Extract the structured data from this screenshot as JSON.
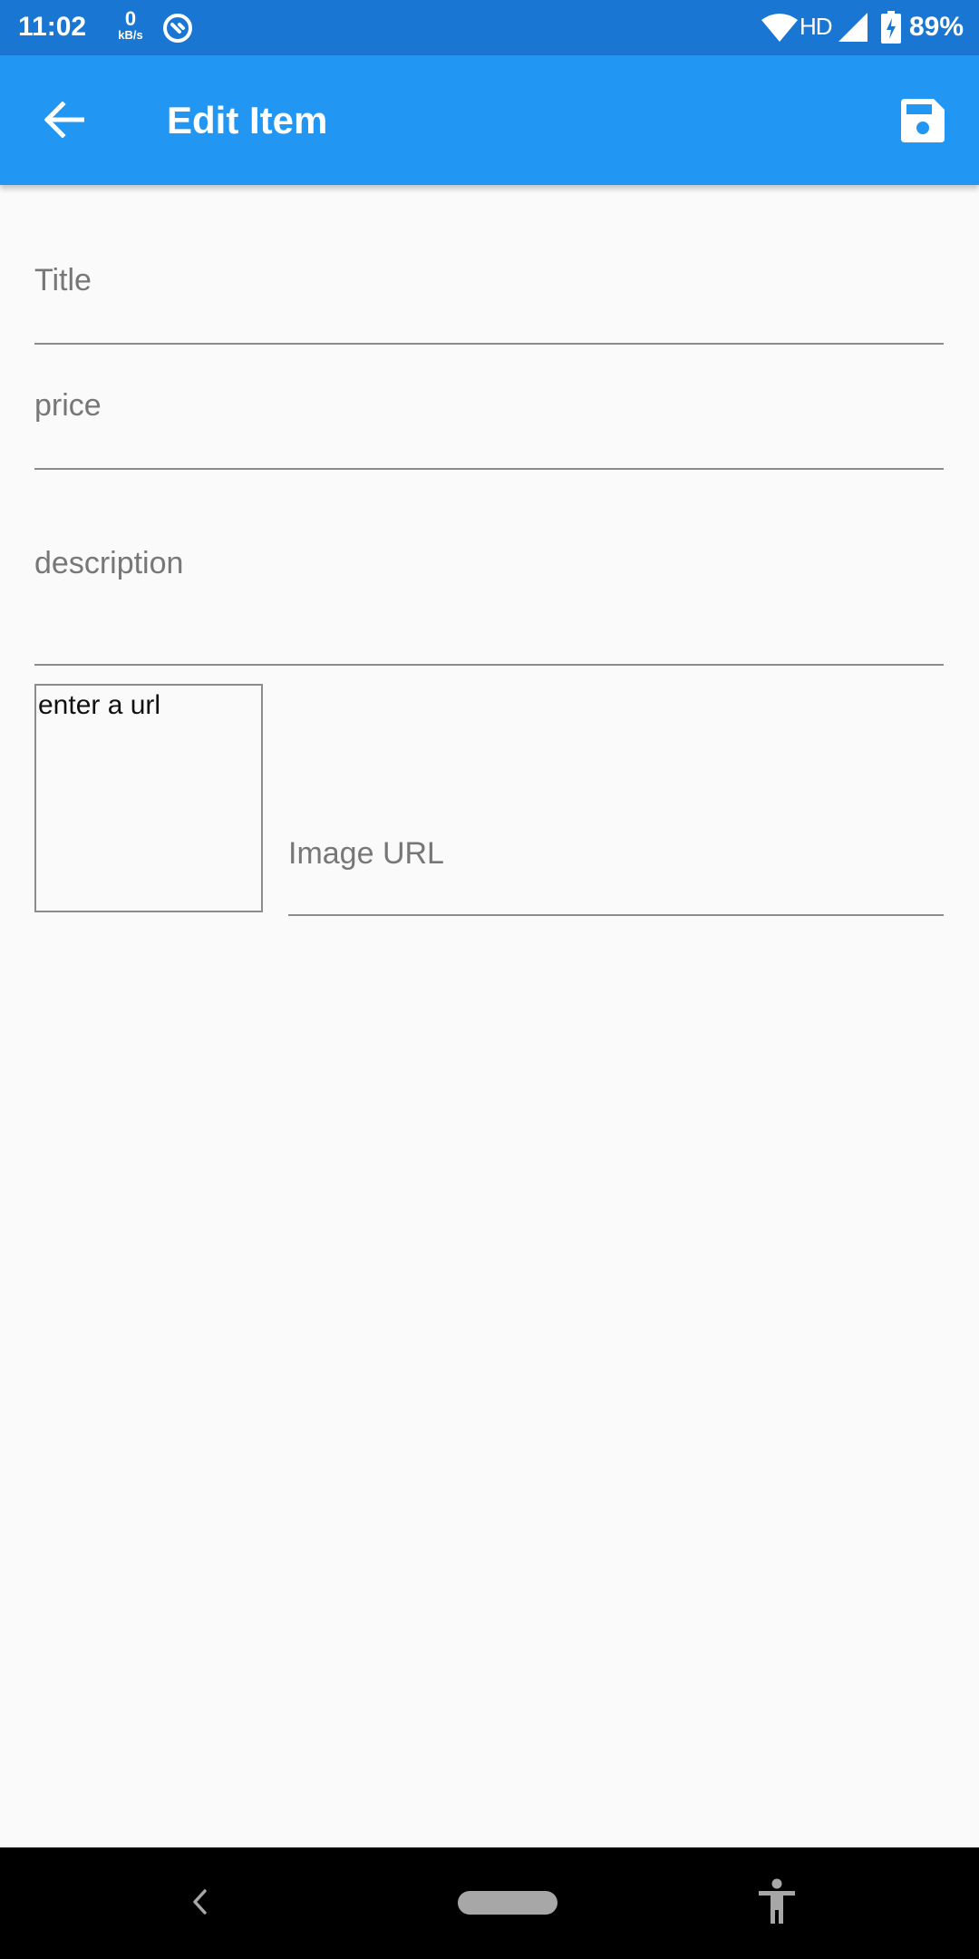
{
  "status_bar": {
    "time": "11:02",
    "net_speed_value": "0",
    "net_speed_unit": "kB/s",
    "network_type": "HD",
    "battery_percent": "89%"
  },
  "app_bar": {
    "title": "Edit Item",
    "back_icon": "arrow-left-icon",
    "save_icon": "floppy-disk-icon",
    "background_color": "#2196f3",
    "status_bar_color": "#1976d2"
  },
  "form": {
    "title_field": {
      "placeholder": "Title",
      "value": ""
    },
    "price_field": {
      "placeholder": "price",
      "value": ""
    },
    "description_field": {
      "placeholder": "description",
      "value": ""
    },
    "image_preview": {
      "text": "enter a url"
    },
    "image_url_field": {
      "placeholder": "Image URL",
      "value": ""
    }
  },
  "nav_bar": {
    "back_icon": "chevron-left-icon",
    "home_icon": "home-pill-icon",
    "accessibility_icon": "accessibility-icon"
  }
}
